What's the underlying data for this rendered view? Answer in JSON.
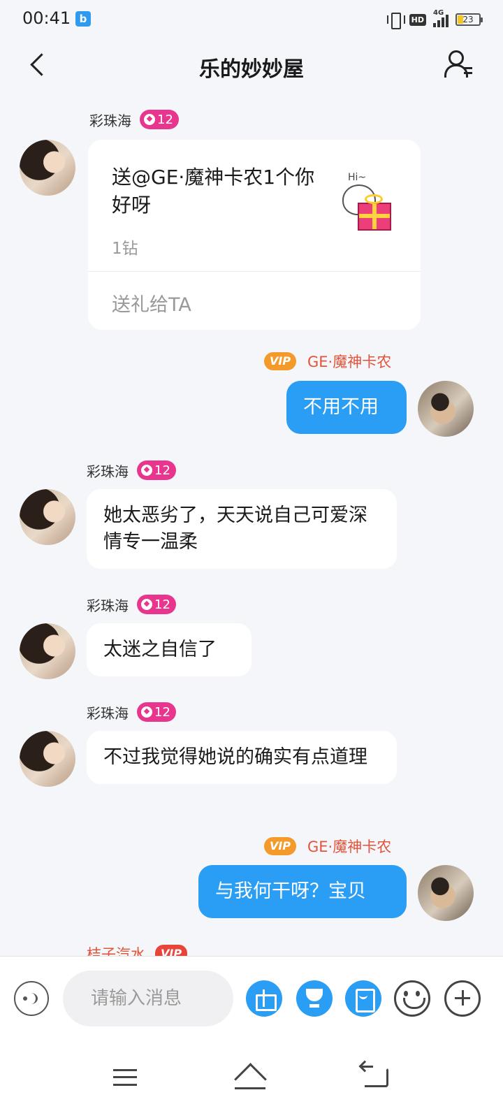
{
  "status_bar": {
    "time": "00:41",
    "app_icon_glyph": "b",
    "network": "4G",
    "hd": "HD",
    "battery_level": "23",
    "battery_color": "#f3c623"
  },
  "header": {
    "title": "乐的妙妙屋",
    "back_icon": "chevron-left-icon",
    "members_icon": "group-members-icon"
  },
  "messages": [
    {
      "type": "gift",
      "sender": "彩珠海",
      "level": "12",
      "gift_text": "送@GE·魔神卡农1个你好呀",
      "sticker_text": "Hi~",
      "price": "1钻",
      "action": "送礼给TA"
    },
    {
      "type": "outgoing",
      "sender": "GE·魔神卡农",
      "vip": "VIP",
      "text": "不用不用"
    },
    {
      "type": "incoming",
      "sender": "彩珠海",
      "level": "12",
      "text": "她太恶劣了，天天说自己可爱深情专一温柔"
    },
    {
      "type": "incoming",
      "sender": "彩珠海",
      "level": "12",
      "text": "太迷之自信了"
    },
    {
      "type": "incoming",
      "sender": "彩珠海",
      "level": "12",
      "text": "不过我觉得她说的确实有点道理"
    },
    {
      "type": "outgoing",
      "sender": "GE·魔神卡农",
      "vip": "VIP",
      "text": "与我何干呀？宝贝"
    }
  ],
  "peek": {
    "sender": "桔子汽水",
    "vip": "VIP"
  },
  "input_bar": {
    "placeholder": "请输入消息",
    "buttons": [
      "voice-icon",
      "gift-icon",
      "trophy-icon",
      "red-packet-icon",
      "emoji-icon",
      "plus-icon"
    ],
    "accent": "#2a9df4"
  },
  "colors": {
    "outgoing_bubble": "#2a9df4",
    "level_badge": "#e8368f",
    "vip_badge": "#f39a2b",
    "self_name": "#e2533a"
  }
}
